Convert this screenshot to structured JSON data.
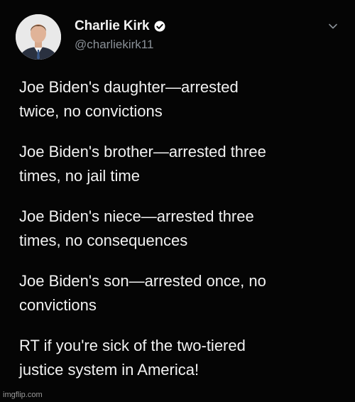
{
  "author": {
    "display_name": "Charlie Kirk",
    "handle": "@charliekirk11",
    "verified": true,
    "avatar_icon": "profile-photo"
  },
  "menu_icon": "chevron-down-icon",
  "tweet": {
    "paragraphs": [
      "Joe Biden's daughter—arrested\ntwice, no convictions",
      "Joe Biden's brother—arrested three\ntimes, no jail time",
      "Joe Biden's niece—arrested three\ntimes, no consequences",
      "Joe Biden's son—arrested once, no\nconvictions",
      "RT if you're sick of the two-tiered\njustice system in America!"
    ]
  },
  "watermark": "imgflip.com",
  "colors": {
    "background": "#050505",
    "text": "#f2f2f2",
    "handle": "#8a9097",
    "verified": "#ffffff"
  }
}
